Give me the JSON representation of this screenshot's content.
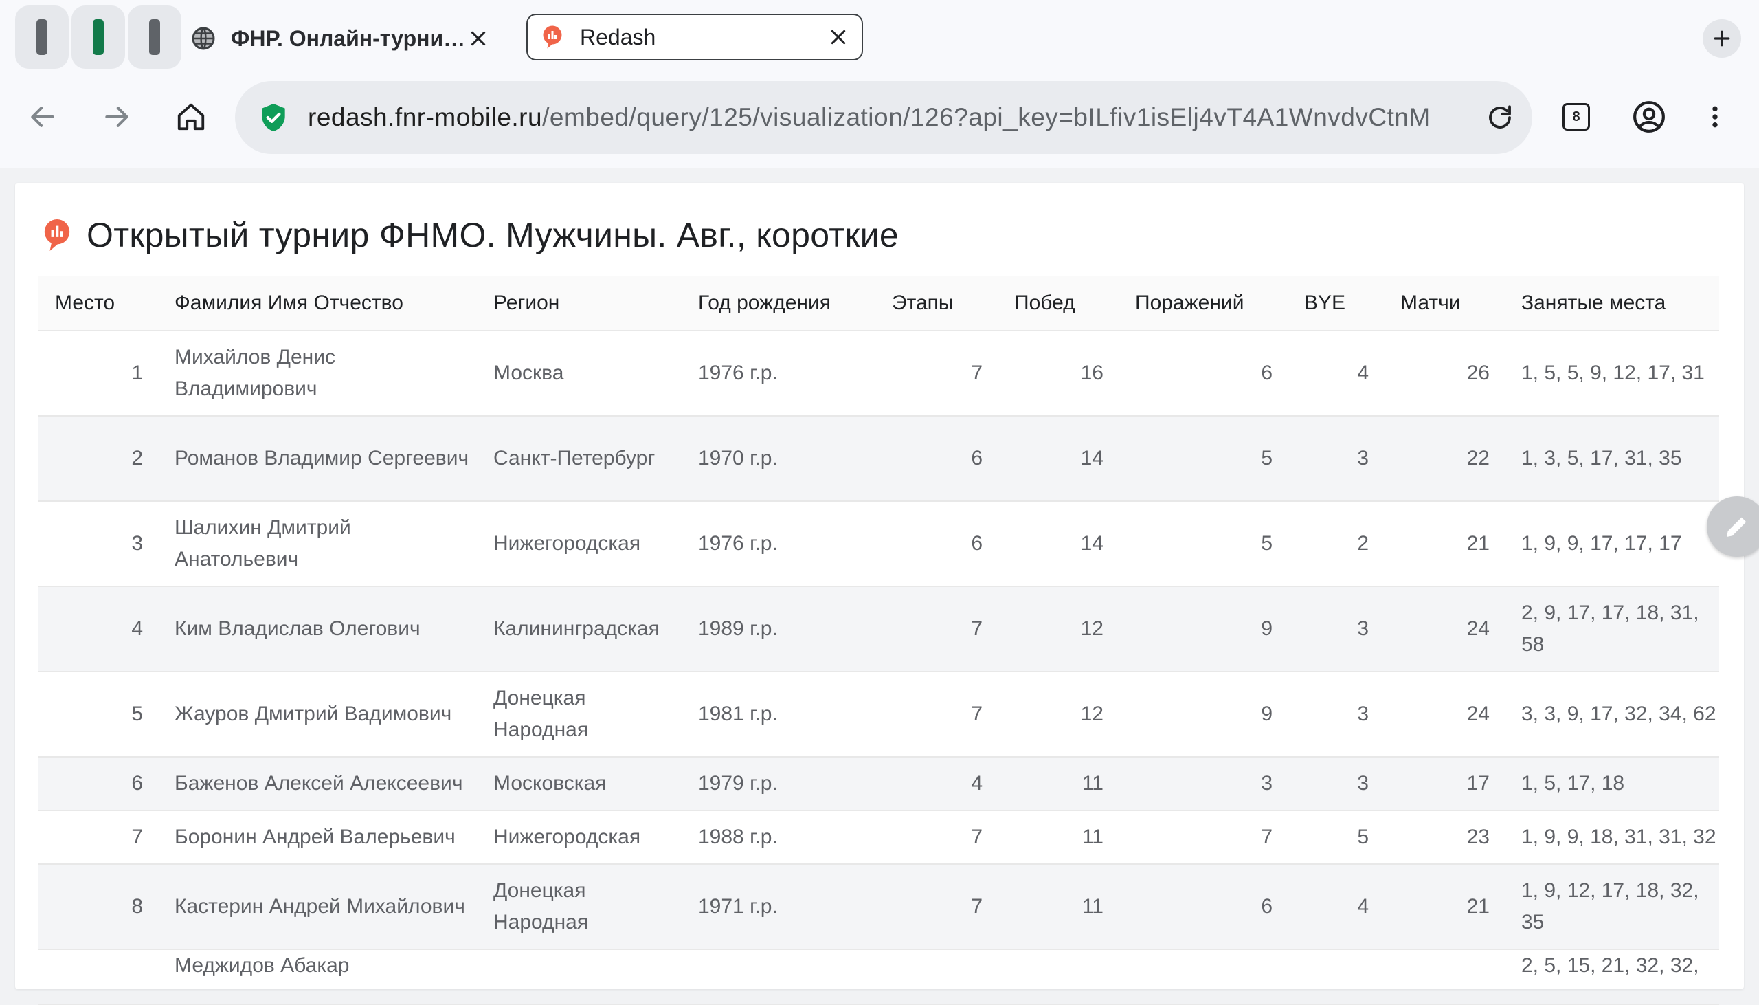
{
  "browser": {
    "tab_groups": [
      {
        "color": "#5f6368"
      },
      {
        "color": "#137a4a"
      },
      {
        "color": "#5f6368"
      }
    ],
    "tabs": [
      {
        "title": "ФНР. Онлайн-турни…",
        "icon": "globe-icon",
        "active": false
      },
      {
        "title": "Redash",
        "icon": "redash-logo-icon",
        "active": true
      }
    ],
    "url_host": "redash.fnr-mobile.ru",
    "url_path": "/embed/query/125/visualization/126?api_key=bILfiv1isElj4vT4A1WnvdvCtnM",
    "tab_count": "8"
  },
  "page": {
    "title": "Открытый турнир ФНМО. Мужчины. Авг., короткие",
    "accent": "#f06449"
  },
  "table": {
    "columns": [
      "Место",
      "Фамилия Имя Отчество",
      "Регион",
      "Год рождения",
      "Этапы",
      "Побед",
      "Поражений",
      "BYE",
      "Матчи",
      "Занятые места"
    ],
    "rows": [
      {
        "place": "1",
        "name": "Михайлов Денис Владимирович",
        "region": "Москва",
        "birth": "1976 г.р.",
        "stages": "7",
        "wins": "16",
        "losses": "6",
        "bye": "4",
        "matches": "26",
        "places": "1, 5, 5, 9, 12, 17, 31"
      },
      {
        "place": "2",
        "name": "Романов Владимир Сергеевич",
        "region": "Санкт-Петербург",
        "birth": "1970 г.р.",
        "stages": "6",
        "wins": "14",
        "losses": "5",
        "bye": "3",
        "matches": "22",
        "places": "1, 3, 5, 17, 31, 35"
      },
      {
        "place": "3",
        "name": "Шалихин Дмитрий Анатольевич",
        "region": "Нижегородская",
        "birth": "1976 г.р.",
        "stages": "6",
        "wins": "14",
        "losses": "5",
        "bye": "2",
        "matches": "21",
        "places": "1, 9, 9, 17, 17, 17"
      },
      {
        "place": "4",
        "name": "Ким Владислав Олегович",
        "region": "Калининградская",
        "birth": "1989 г.р.",
        "stages": "7",
        "wins": "12",
        "losses": "9",
        "bye": "3",
        "matches": "24",
        "places": "2, 9, 17, 17, 18, 31, 58"
      },
      {
        "place": "5",
        "name": "Жауров Дмитрий Вадимович",
        "region": "Донецкая Народная",
        "birth": "1981 г.р.",
        "stages": "7",
        "wins": "12",
        "losses": "9",
        "bye": "3",
        "matches": "24",
        "places": "3, 3, 9, 17, 32, 34, 62"
      },
      {
        "place": "6",
        "name": "Баженов Алексей Алексеевич",
        "region": "Московская",
        "birth": "1979 г.р.",
        "stages": "4",
        "wins": "11",
        "losses": "3",
        "bye": "3",
        "matches": "17",
        "places": "1, 5, 17, 18"
      },
      {
        "place": "7",
        "name": "Боронин Андрей Валерьевич",
        "region": "Нижегородская",
        "birth": "1988 г.р.",
        "stages": "7",
        "wins": "11",
        "losses": "7",
        "bye": "5",
        "matches": "23",
        "places": "1, 9, 9, 18, 31, 31, 32"
      },
      {
        "place": "8",
        "name": "Кастерин Андрей Михайлович",
        "region": "Донецкая Народная",
        "birth": "1971 г.р.",
        "stages": "7",
        "wins": "11",
        "losses": "6",
        "bye": "4",
        "matches": "21",
        "places": "1, 9, 12, 17, 18, 32, 35"
      },
      {
        "place": "",
        "name": "Меджидов Абакар",
        "region": "",
        "birth": "",
        "stages": "",
        "wins": "",
        "losses": "",
        "bye": "",
        "matches": "",
        "places": "2, 5, 15, 21, 32, 32,"
      }
    ]
  }
}
